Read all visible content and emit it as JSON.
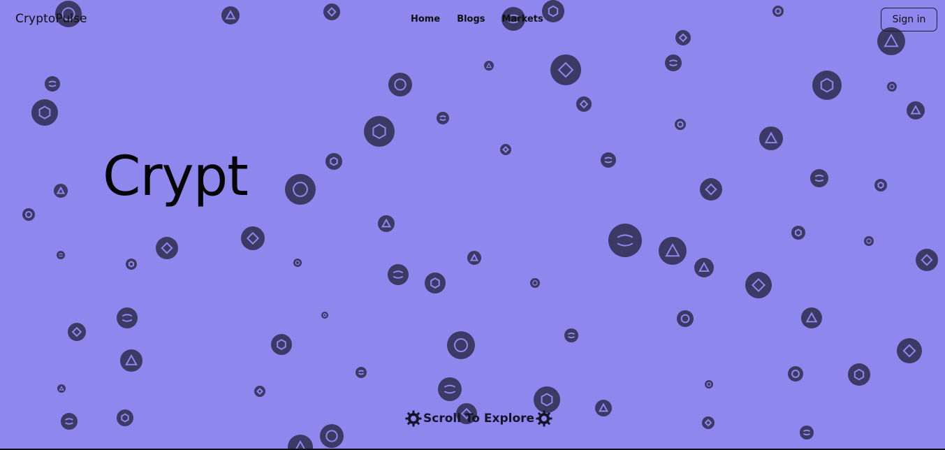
{
  "header": {
    "brand": "CryptoPulse",
    "nav": [
      "Home",
      "Blogs",
      "Markets"
    ],
    "signin_label": "Sign in"
  },
  "hero": {
    "title_partial": "Crypt"
  },
  "cta": {
    "scroll_label": "Scroll To Explore",
    "left_icon": "gear-icon",
    "right_icon": "gear-icon"
  },
  "background": {
    "description_icon": "crypto-coin-icon",
    "colors": {
      "page": "#8d87ee",
      "coin": "#3d3965",
      "text": "#111111"
    }
  }
}
